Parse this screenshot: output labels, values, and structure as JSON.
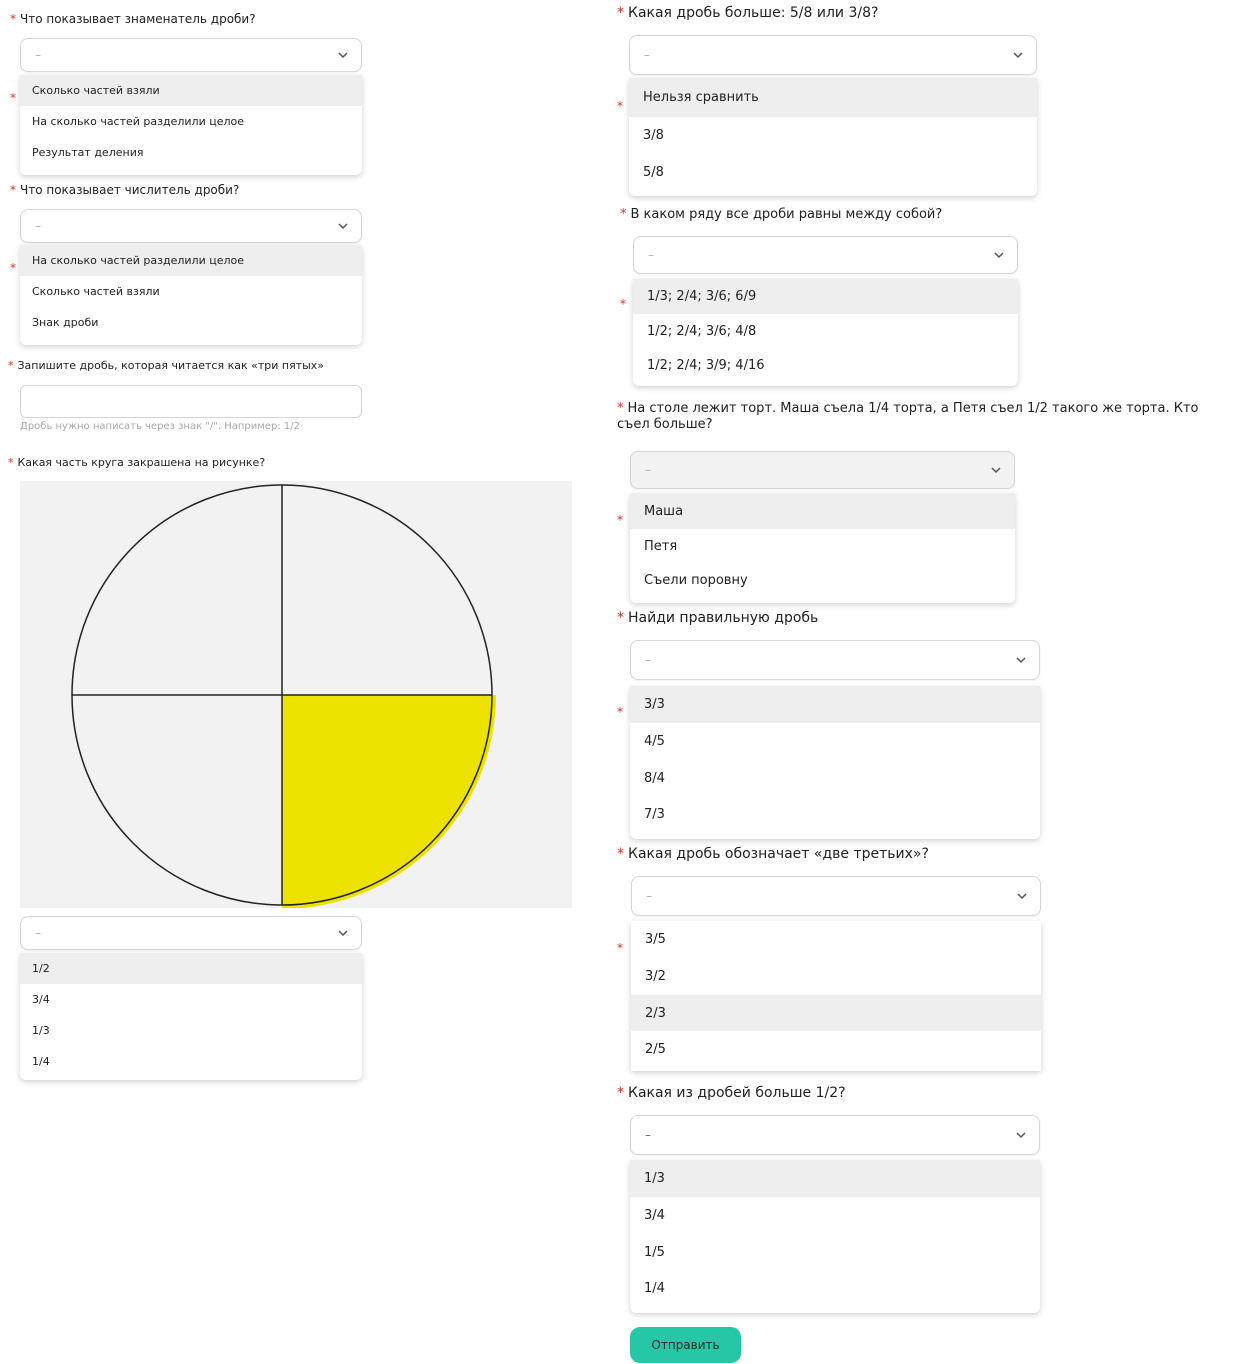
{
  "placeholder": "–",
  "left": {
    "q1": {
      "text": "Что показывает знаменатель дроби?",
      "options": [
        "Сколько частей взяли",
        "На сколько частей разделили целое",
        "Результат деления"
      ]
    },
    "q2": {
      "text": "Что показывает числитель дроби?",
      "options": [
        "На сколько частей разделили целое",
        "Сколько частей взяли",
        "Знак дроби"
      ]
    },
    "q3": {
      "text": "Запишите дробь, которая читается как «три пятых»",
      "hint": "Дробь нужно написать через знак \"/\". Например: 1/2"
    },
    "q4": {
      "text": "Какая часть круга закрашена на рисунке?",
      "options": [
        "1/2",
        "3/4",
        "1/3",
        "1/4"
      ]
    }
  },
  "circle": {
    "parts": 4,
    "shaded_parts": 1,
    "shade_color": "#ede100"
  },
  "right": {
    "q5": {
      "text": "Какая дробь больше: 5/8 или 3/8?",
      "options": [
        "Нельзя сравнить",
        "3/8",
        "5/8"
      ]
    },
    "q6": {
      "text": "В каком ряду все дроби равны между собой?",
      "options": [
        "1/3; 2/4; 3/6; 6/9",
        "1/2; 2/4; 3/6; 4/8",
        "1/2; 2/4; 3/9; 4/16"
      ]
    },
    "q7": {
      "text": "На столе лежит торт. Маша съела 1/4 торта, а Петя съел 1/2 такого же торта. Кто съел больше?",
      "options": [
        "Маша",
        "Петя",
        "Съели поровну"
      ]
    },
    "q8": {
      "text": "Найди правильную дробь",
      "options": [
        "3/3",
        "4/5",
        "8/4",
        "7/3"
      ]
    },
    "q9": {
      "text": "Какая дробь обозначает «две третьих»?",
      "options": [
        "3/5",
        "3/2",
        "2/3",
        "2/5"
      ]
    },
    "q10": {
      "text": "Какая из дробей больше 1/2?",
      "options": [
        "1/3",
        "3/4",
        "1/5",
        "1/4"
      ]
    }
  },
  "submit_label": "Отправить",
  "accent_color": "#25c7a7",
  "required_color": "#e0301e"
}
